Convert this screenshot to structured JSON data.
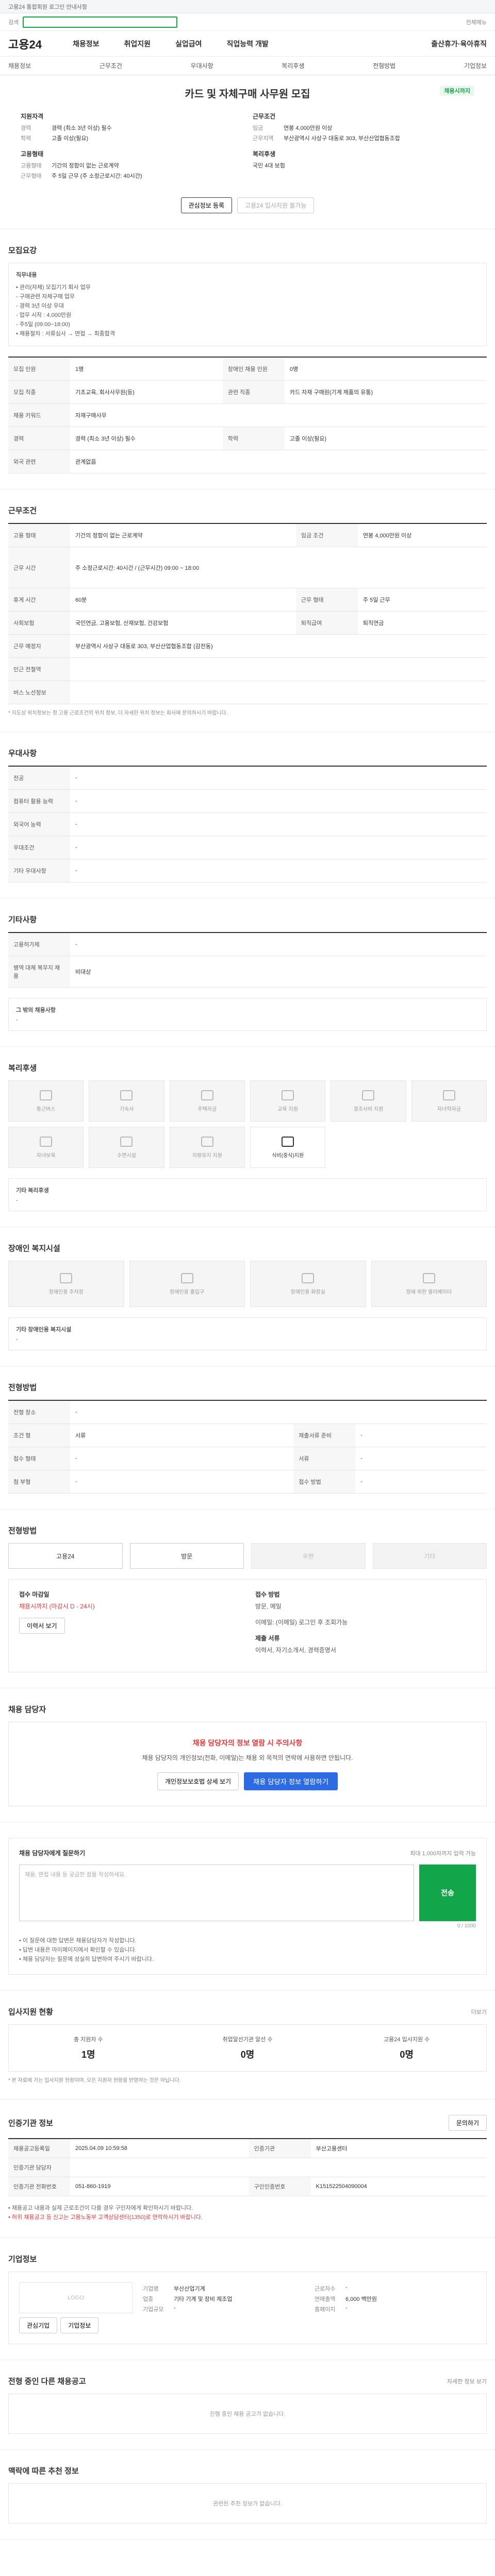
{
  "topbar": {
    "text": "고용24 통합회원 로그인 안내사항"
  },
  "search": {
    "label": "검색",
    "placeholder": "",
    "right": "전체메뉴"
  },
  "gnb": {
    "logo": "고용24",
    "items": [
      "채용정보",
      "취업지원",
      "실업급여",
      "직업능력 개발"
    ],
    "right": "출산휴가·육아휴직"
  },
  "subnav": [
    "채용정보",
    "근무조건",
    "우대사항",
    "복리후생",
    "전형방법",
    "기업정보"
  ],
  "hero": {
    "title": "카드 및 자체구매 사무원 모집",
    "badge": "채용시까지",
    "left_heading": "지원자격",
    "left_kv": [
      {
        "k": "경력",
        "v": "경력 (최소 3년 이상) 필수"
      },
      {
        "k": "학력",
        "v": "고졸 이상(필요)"
      }
    ],
    "left_heading2": "고용형태",
    "left_kv2": [
      {
        "k": "고용형태",
        "v": "기간의 정함이 없는 근로계약"
      },
      {
        "k": "근무형태",
        "v": "주 5일 근무 (주 소정근로시간: 40시간)"
      }
    ],
    "right_heading": "근무조건",
    "right_kv": [
      {
        "k": "임금",
        "v": "연봉 4,000만원 이상"
      },
      {
        "k": "근무지역",
        "v": "부산광역시 사상구 대동로 303, 부산산업협동조합"
      }
    ],
    "right_heading2": "복리후생",
    "right_kv2": [
      {
        "k": "",
        "v": "국민 4대 보험"
      }
    ],
    "btn1": "관심정보 등록",
    "btn2": "고용24 입사지원 불가능"
  },
  "recruit": {
    "title": "모집요강",
    "notice_title": "직무내용",
    "notice_lines": [
      "• 관리(자체) 모집기기 회사 업무",
      "- 구매관련 자체구매 업무",
      "- 경력 3년 이상 우대",
      "- 업무 시작 : 4,000만원",
      "- 주5일 (09:00~18:00)",
      "• 채용절차 : 서류심사 → 면접 → 최종합격"
    ],
    "rows": [
      {
        "k": "모집 인원",
        "v": "1명",
        "k2": "장애인 채용 인원",
        "v2": "0명"
      },
      {
        "k": "모집 직종",
        "v": "기초교육, 회사사무원(등)",
        "k2": "관련 직종",
        "v2": "카드 자재 구매원(기계 제품의 유통)"
      },
      {
        "k": "채용 키워드",
        "v": "자재구매사무",
        "k2": "",
        "v2": ""
      },
      {
        "k": "경력",
        "v": "경력 (최소 3년 이상) 필수",
        "k2": "학력",
        "v2": "고졸 이상(필요)"
      },
      {
        "k": "외국 관련",
        "v": "관계없음",
        "k2": "",
        "v2": ""
      }
    ]
  },
  "conditions": {
    "title": "근무조건",
    "rows": [
      {
        "k": "고용 형태",
        "v": "기간의 정함이 없는 근로계약",
        "k2": "임금 조건",
        "v2": "연봉 4,000만원 이상"
      },
      {
        "k": "근무 시간",
        "v": "주 소정근로시간: 40시간 / (근무시간) 09:00 ~ 18:00",
        "k2": "",
        "v2": ""
      },
      {
        "k": "휴게 시간",
        "v": "60분",
        "k2": "근무 형태",
        "v2": "주 5일 근무"
      },
      {
        "k": "사회보험",
        "v": "국민연금, 고용보험, 산재보험, 건강보험",
        "k2": "퇴직급여",
        "v2": "퇴직연금"
      },
      {
        "k": "근무 예정지",
        "v": "부산광역시 사상구 대동로 303, 부산산업협동조합 (감전동)",
        "k2": "",
        "v2": ""
      },
      {
        "k": "인근 전철역",
        "v": "",
        "k2": "",
        "v2": ""
      },
      {
        "k": "버스 노선정보",
        "v": "",
        "k2": "",
        "v2": ""
      }
    ],
    "footnote": "* 지도상 위치정보는 정 고용 근로조건의 위치 정보, 더 자세한 위치 정보는 회사에 문의하시기 바랍니다."
  },
  "prefer": {
    "title": "우대사항",
    "rows": [
      {
        "k": "전공",
        "v": "-"
      },
      {
        "k": "컴퓨터 활용 능력",
        "v": "-"
      },
      {
        "k": "외국어 능력",
        "v": "-"
      },
      {
        "k": "우대조건",
        "v": "-"
      },
      {
        "k": "기타 우대사항",
        "v": "-"
      }
    ]
  },
  "other": {
    "title": "기타사항",
    "rows": [
      {
        "k": "고용허가제",
        "v": "-"
      },
      {
        "k": "병역 대체 복무지 채용",
        "v": "비대상"
      }
    ],
    "etc_label": "그 밖의 채용사항",
    "etc_value": "-"
  },
  "welfare": {
    "title": "복리후생",
    "items": [
      "통근버스",
      "기숙사",
      "주택자금",
      "교육 지원",
      "경조사비 지원",
      "자녀학자금",
      "자녀보육",
      "수면시설",
      "차량유지 지원",
      "식비(중식)지원"
    ],
    "active_index": 9,
    "etc_label": "기타 복리후생",
    "etc_value": "-"
  },
  "disabled": {
    "title": "장애인 복지시설",
    "items": [
      "장애인용 주차장",
      "장애인용 출입구",
      "장애인용 화장실",
      "장애 위한 엘리베이터"
    ],
    "etc_label": "기타 장애인용 복지시설",
    "etc_value": "-"
  },
  "process": {
    "title": "전형방법",
    "rows": [
      {
        "k": "전형 장소",
        "v": "-",
        "k2": "",
        "v2": ""
      },
      {
        "k": "조건 형",
        "v": "서류",
        "k2": "제출서류 준비",
        "v2": "-"
      },
      {
        "k": "접수 형태",
        "v": "-",
        "k2": "서류",
        "v2": "-"
      },
      {
        "k": "첨 부형",
        "v": "-",
        "k2": "접수 방법",
        "v2": "-"
      }
    ]
  },
  "apply": {
    "title": "전형방법",
    "methods": [
      "고용24",
      "방문",
      "우편",
      "기타"
    ],
    "disabled_methods": [
      2,
      3
    ],
    "resume": {
      "l1": "접수 마감일",
      "l1v": "채용시까지 (마감시 D - 24시)",
      "l2": "접수 방법",
      "l2v": "방문, 메일",
      "l2v2": "이메일: (이메일) 로그인 후 조회가능",
      "l3": "제출 서류",
      "l3v": "이력서, 자기소개서, 경력증명서",
      "btn": "이력서 보기"
    }
  },
  "manager": {
    "title": "채용 담당자",
    "warn_title": "채용 담당자의 정보 열람 시 주의사항",
    "warn_text": "채용 담당자의 개인정보(전화, 이메일)는 채용 외 목적의 연락에 사용하면 안됩니다.",
    "btn1": "개인정보보호법 상세 보기",
    "btn2": "채용 담당자 정보 열람하기"
  },
  "inquiry": {
    "title": "채용 담당자에게 질문하기",
    "note": "최대 1,000자까지 입력 가능",
    "placeholder": "채용, 면접 내용 등 궁금한 점을 작성하세요.",
    "send": "전송",
    "count": "0 / 1000",
    "bullets": [
      "• 이 질문에 대한 답변은 채용담당자가 작성합니다.",
      "• 답변 내용은 마이페이지에서 확인할 수 있습니다.",
      "• 채용 담당자는 질문에 성실히 답변하여 주시기 바랍니다."
    ]
  },
  "applicants": {
    "title": "입사지원 현황",
    "more": "더보기",
    "stats": [
      {
        "label": "총 지원자 수",
        "value": "1명"
      },
      {
        "label": "취업알선기관 알선 수",
        "value": "0명"
      },
      {
        "label": "고용24 입사지원 수",
        "value": "0명"
      }
    ],
    "foot": "* 본 자료에 가는 입사지원 현황이며, 모든 지원자 현황을 반영하는 것은 아닙니다."
  },
  "agency": {
    "title": "인증기관 정보",
    "btn": "문의하기",
    "rows": [
      {
        "k": "채용공고등록일",
        "v": "2025.04.09 10:59:58",
        "k2": "인증기관",
        "v2": "부산고용센터"
      },
      {
        "k": "인증기관 담당자",
        "v": "",
        "k2": "",
        "v2": ""
      },
      {
        "k": "인증기관 전화번호",
        "v": "051-860-1919",
        "k2": "구인인증번호",
        "v2": "K151522504090004"
      }
    ],
    "notes": [
      "• 채용공고 내용과 실제 근로조건이 다를 경우 구인자에게 확인하시기 바랍니다.",
      "• 허위 채용공고 등 신고는 고용노동부 고객상담센터(1350)로 연락하시기 바랍니다."
    ]
  },
  "company": {
    "title": "기업정보",
    "logo": "LOGO",
    "btn1": "관심기업",
    "btn2": "기업정보",
    "kv": [
      {
        "k": "기업명",
        "v": "부산산업기계"
      },
      {
        "k": "업종",
        "v": "기타 기계 및 장비 제조업"
      },
      {
        "k": "기업규모",
        "v": "-"
      },
      {
        "k": "근로자수",
        "v": "-"
      },
      {
        "k": "연매출액",
        "v": "6,000 백만원"
      },
      {
        "k": "홈페이지",
        "v": "-"
      }
    ]
  },
  "other_posts": {
    "title": "전형 중인 다른 채용공고",
    "more": "자세한 정보 보기",
    "empty": "진행 중인 채용 공고가 없습니다."
  },
  "recommend": {
    "title": "맥락에 따른 추천 정보",
    "empty": "관련된 추천 정보가 없습니다."
  }
}
